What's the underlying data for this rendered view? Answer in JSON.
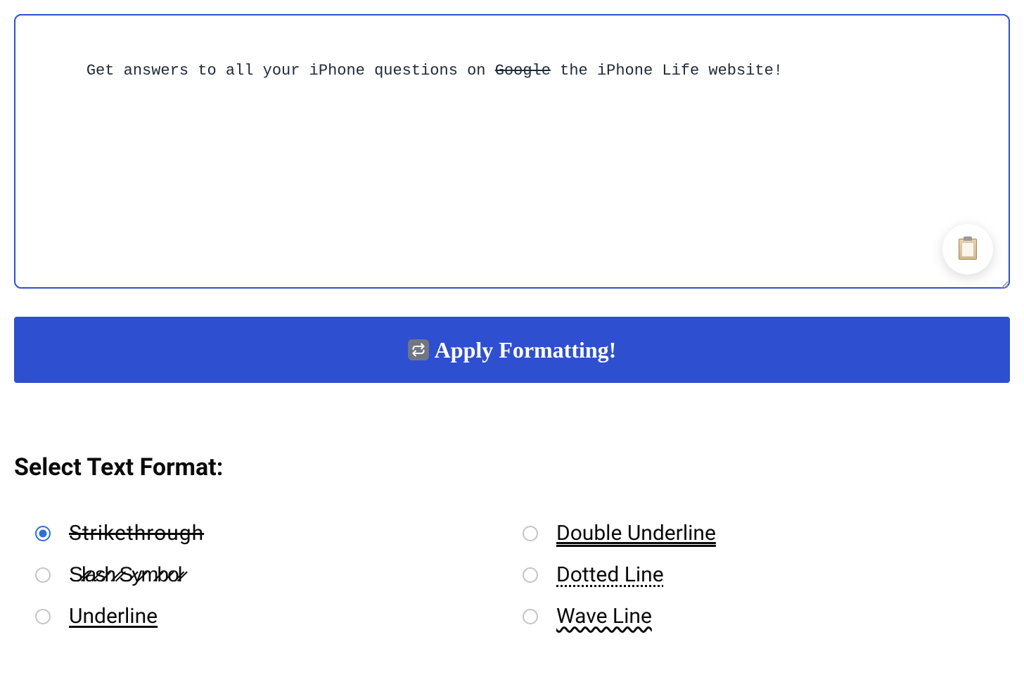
{
  "output": {
    "text_before": "Get answers to all your iPhone questions on ",
    "text_struck": "Google",
    "text_after": " the iPhone Life website!"
  },
  "apply_button": {
    "label": "Apply Formatting!"
  },
  "section": {
    "heading": "Select Text Format:"
  },
  "formats": {
    "strikethrough": {
      "label": " Strikethrough ",
      "selected": true
    },
    "slash": {
      "label": "S̷l̷a̷s̷h̷ ̷S̷y̷m̷b̷o̷l̷",
      "selected": false
    },
    "underline": {
      "label": "Underline ",
      "selected": false
    },
    "double_underline": {
      "label": "Double Underline",
      "selected": false
    },
    "dotted": {
      "label": "Dotted Line",
      "selected": false
    },
    "wave": {
      "label": "Wave Line",
      "selected": false
    }
  }
}
